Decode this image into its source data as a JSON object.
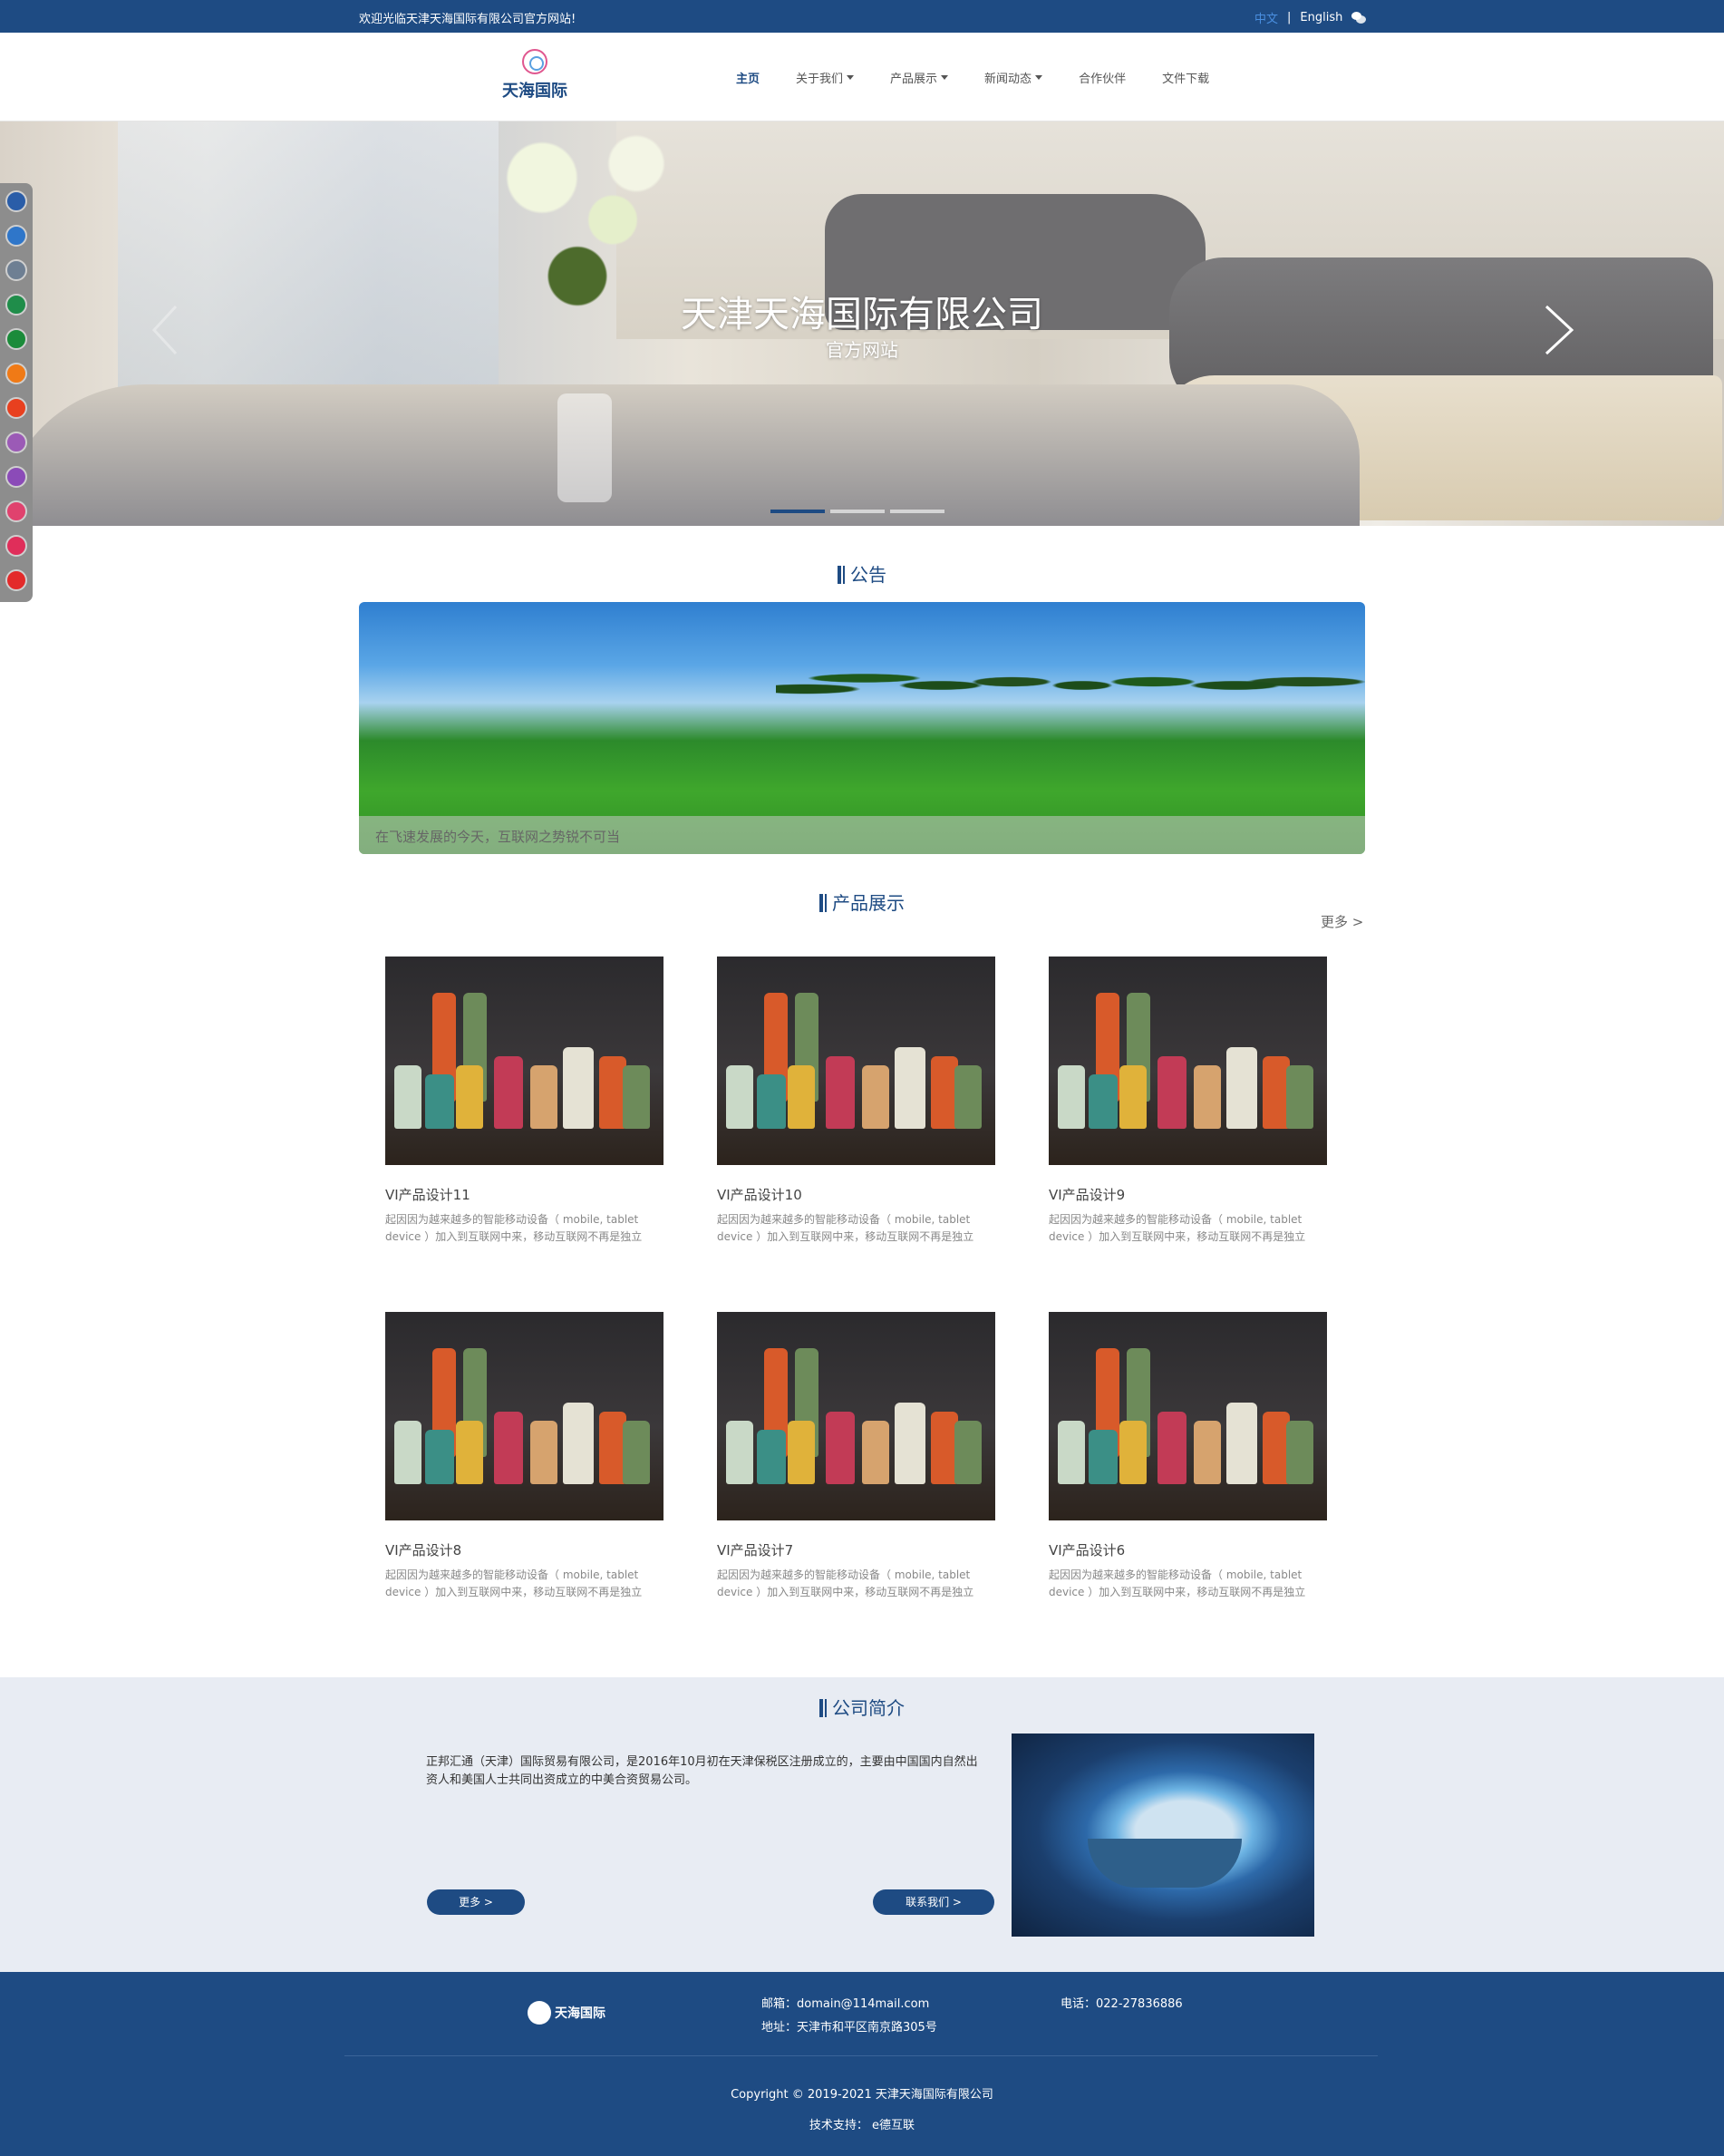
{
  "topbar": {
    "welcome": "欢迎光临天津天海国际有限公司官方网站!",
    "lang_zh": "中文",
    "lang_sep": "|",
    "lang_en": "English",
    "wechat_icon": "wechat-icon"
  },
  "header": {
    "logo_text": "天海国际",
    "nav": [
      {
        "label": "主页",
        "active": true
      },
      {
        "label": "关于我们",
        "dropdown": true
      },
      {
        "label": "产品展示",
        "dropdown": true
      },
      {
        "label": "新闻动态",
        "dropdown": true
      },
      {
        "label": "合作伙伴"
      },
      {
        "label": "文件下载"
      }
    ]
  },
  "banner": {
    "title": "天津天海国际有限公司",
    "subtitle": "官方网站",
    "slides": 3,
    "active_slide": 1
  },
  "swatches": [
    "#2a5da8",
    "#2f76c9",
    "#6e7f93",
    "#1f8d4a",
    "#1b8b3a",
    "#f07a16",
    "#e8401f",
    "#9b5ab6",
    "#8b4bb8",
    "#e0426e",
    "#e02e5a",
    "#e32a2a"
  ],
  "notice": {
    "title": "公告",
    "caption": "在飞速发展的今天，互联网之势锐不可当"
  },
  "products": {
    "title": "产品展示",
    "more": "更多 >",
    "items": [
      {
        "name": "VI产品设计11",
        "desc": "起因因为越来越多的智能移动设备（ mobile, tablet device ）加入到互联网中来，移动互联网不再是独立"
      },
      {
        "name": "VI产品设计10",
        "desc": "起因因为越来越多的智能移动设备（ mobile, tablet device ）加入到互联网中来，移动互联网不再是独立"
      },
      {
        "name": "VI产品设计9",
        "desc": "起因因为越来越多的智能移动设备（ mobile, tablet device ）加入到互联网中来，移动互联网不再是独立"
      },
      {
        "name": "VI产品设计8",
        "desc": "起因因为越来越多的智能移动设备（ mobile, tablet device ）加入到互联网中来，移动互联网不再是独立"
      },
      {
        "name": "VI产品设计7",
        "desc": "起因因为越来越多的智能移动设备（ mobile, tablet device ）加入到互联网中来，移动互联网不再是独立"
      },
      {
        "name": "VI产品设计6",
        "desc": "起因因为越来越多的智能移动设备（ mobile, tablet device ）加入到互联网中来，移动互联网不再是独立"
      }
    ]
  },
  "about": {
    "title": "公司简介",
    "text": "正邦汇通（天津）国际贸易有限公司，是2016年10月初在天津保税区注册成立的，主要由中国国内自然出资人和美国人士共同出资成立的中美合资贸易公司。",
    "more_btn": "更多 >",
    "contact_btn": "联系我们 >"
  },
  "footer": {
    "logo_text": "天海国际",
    "email": "邮箱：domain@114mail.com",
    "address": "地址：天津市和平区南京路305号",
    "phone": "电话：022-27836886",
    "copyright": "Copyright © 2019-2021 天津天海国际有限公司",
    "support": "技术支持：  e德互联"
  }
}
